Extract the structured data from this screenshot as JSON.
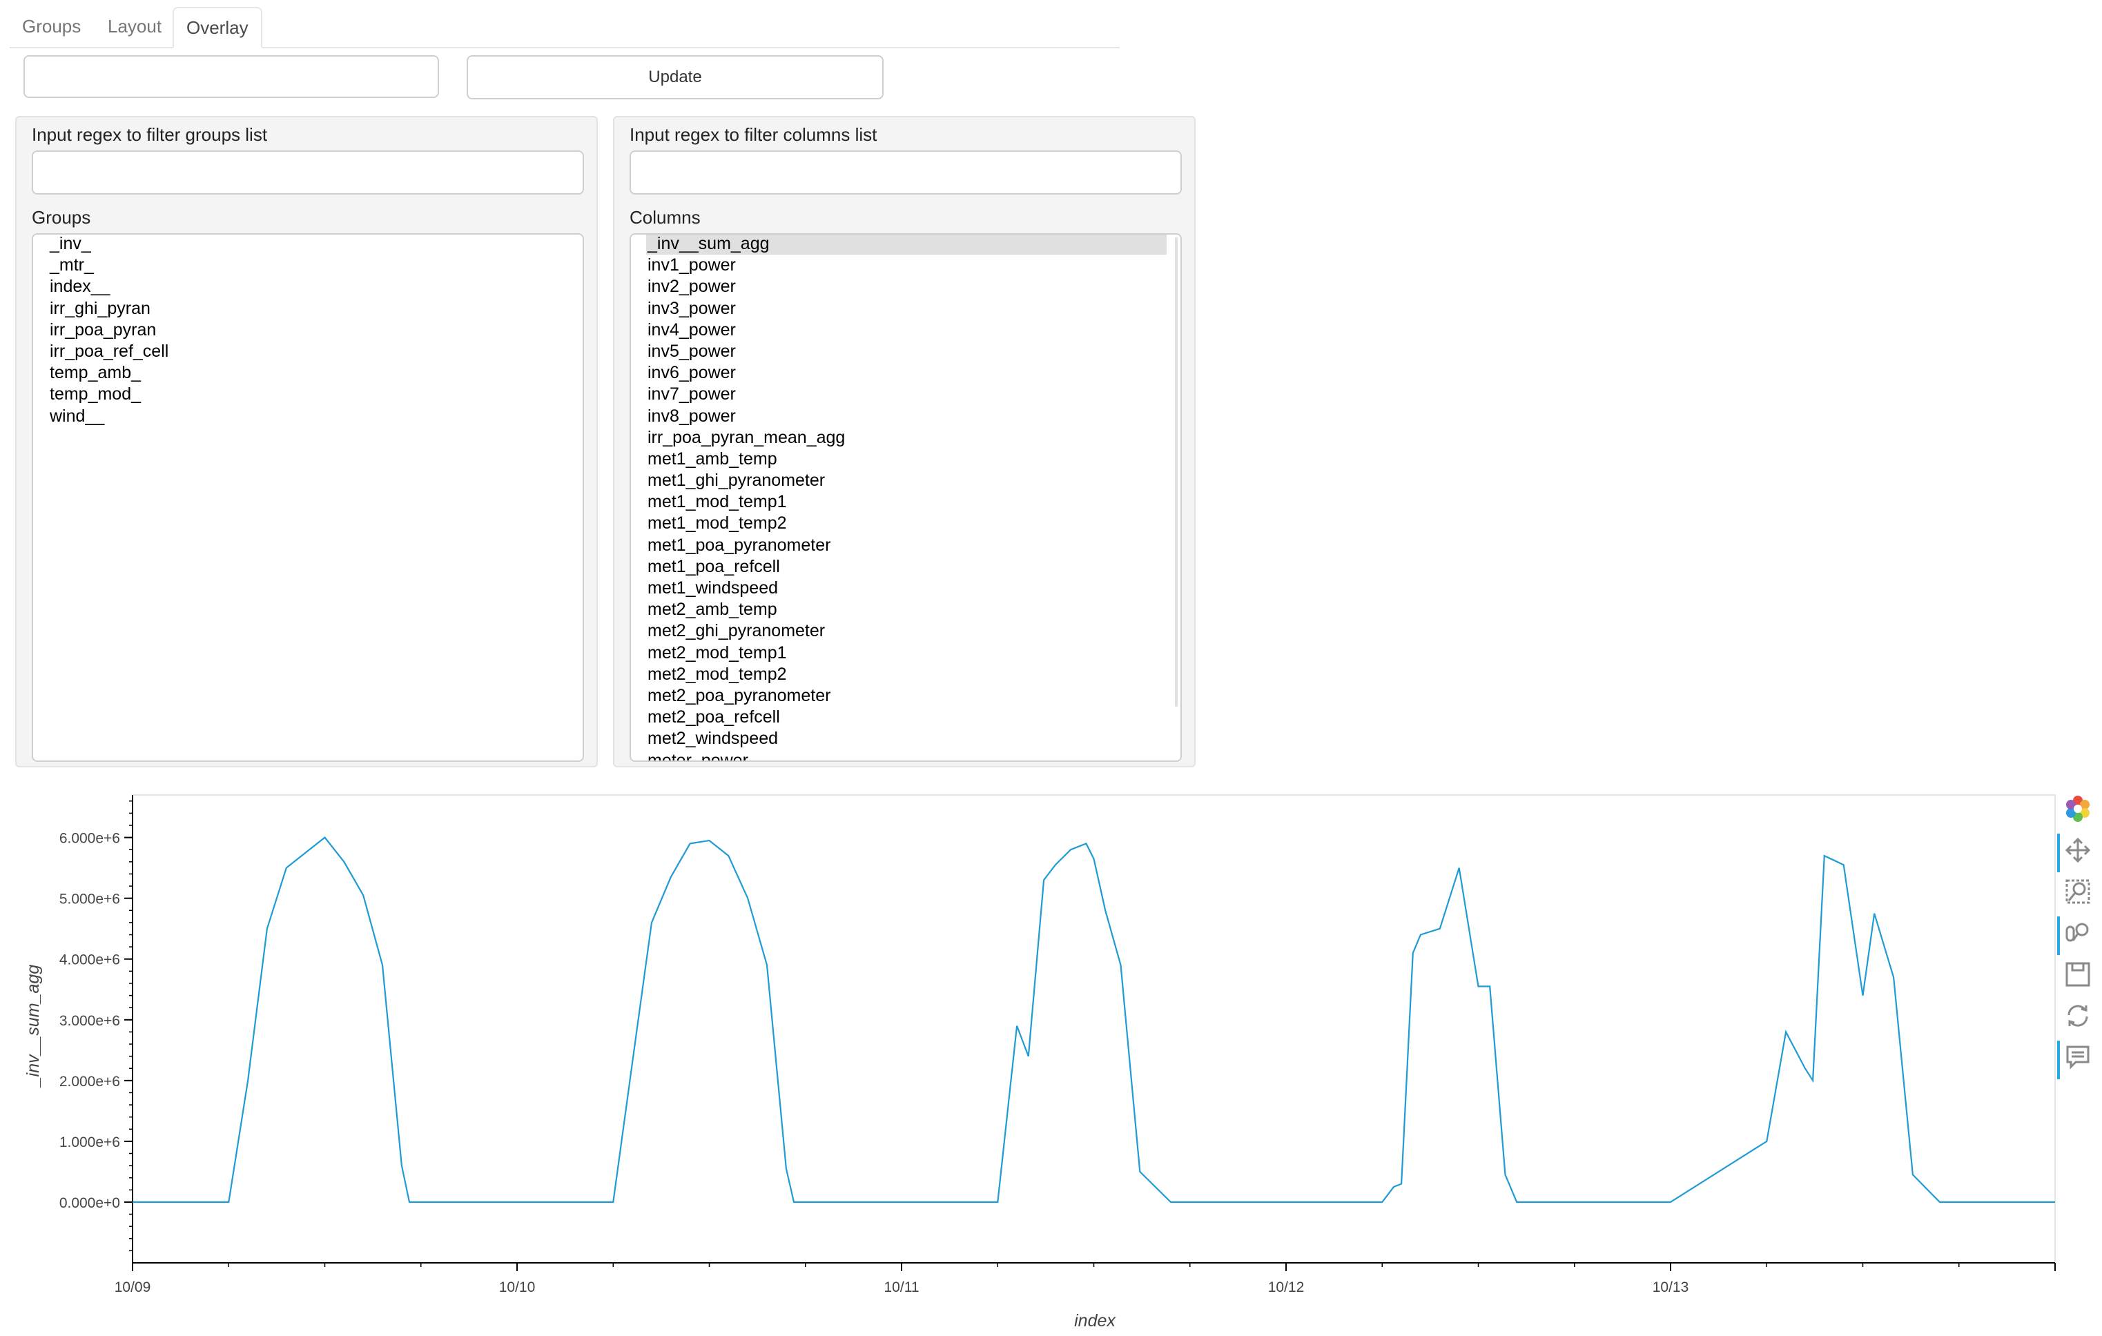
{
  "tabs": [
    {
      "label": "Groups"
    },
    {
      "label": "Layout"
    },
    {
      "label": "Overlay",
      "active": true
    }
  ],
  "controls": {
    "top_input_value": "",
    "update_label": "Update"
  },
  "groups_panel": {
    "filter_label": "Input regex to filter groups list",
    "filter_value": "",
    "list_label": "Groups",
    "items": [
      "_inv_",
      "_mtr_",
      "index__",
      "irr_ghi_pyran",
      "irr_poa_pyran",
      "irr_poa_ref_cell",
      "temp_amb_",
      "temp_mod_",
      "wind__"
    ]
  },
  "columns_panel": {
    "filter_label": "Input regex to filter columns list",
    "filter_value": "",
    "list_label": "Columns",
    "selected": "_inv__sum_agg",
    "items": [
      "_inv__sum_agg",
      "inv1_power",
      "inv2_power",
      "inv3_power",
      "inv4_power",
      "inv5_power",
      "inv6_power",
      "inv7_power",
      "inv8_power",
      "irr_poa_pyran_mean_agg",
      "met1_amb_temp",
      "met1_ghi_pyranometer",
      "met1_mod_temp1",
      "met1_mod_temp2",
      "met1_poa_pyranometer",
      "met1_poa_refcell",
      "met1_windspeed",
      "met2_amb_temp",
      "met2_ghi_pyranometer",
      "met2_mod_temp1",
      "met2_mod_temp2",
      "met2_poa_pyranometer",
      "met2_poa_refcell",
      "met2_windspeed",
      "meter_power"
    ]
  },
  "toolbar": {
    "icons": [
      "bokeh-logo-icon",
      "pan-icon",
      "box-zoom-icon",
      "wheel-zoom-icon",
      "save-icon",
      "reset-icon",
      "hover-icon"
    ]
  },
  "chart_data": {
    "type": "line",
    "xlabel": "index",
    "ylabel": "_inv__sum_agg",
    "line_color": "#1f9bd6",
    "x_ticks": [
      "10/09",
      "10/10",
      "10/11",
      "10/12",
      "10/13"
    ],
    "xlim_days": [
      0,
      5.0
    ],
    "y_ticks": [
      "0.000e+0",
      "1.000e+6",
      "2.000e+6",
      "3.000e+6",
      "4.000e+6",
      "5.000e+6",
      "6.000e+6"
    ],
    "ylim": [
      -1000000,
      6700000
    ],
    "grid": false,
    "series": [
      {
        "x": [
          0,
          0.25,
          0.3,
          0.35,
          0.4,
          0.45,
          0.5,
          0.55,
          0.6,
          0.65,
          0.7,
          0.72,
          0.75,
          1.0,
          1.25,
          1.3,
          1.35,
          1.4,
          1.45,
          1.5,
          1.55,
          1.6,
          1.65,
          1.7,
          1.72,
          1.75,
          2.0,
          2.25,
          2.3,
          2.33,
          2.37,
          2.4,
          2.44,
          2.48,
          2.5,
          2.53,
          2.57,
          2.62,
          2.7,
          2.75,
          3.0,
          3.25,
          3.28,
          3.3,
          3.33,
          3.35,
          3.4,
          3.45,
          3.5,
          3.53,
          3.57,
          3.6,
          3.7,
          3.75,
          4.0,
          4.25,
          4.3,
          4.35,
          4.37,
          4.4,
          4.45,
          4.5,
          4.53,
          4.58,
          4.63,
          4.7,
          4.75,
          5.0
        ],
        "y": [
          0,
          0,
          2000000,
          4500000,
          5500000,
          5750000,
          6000000,
          5600000,
          5050000,
          3900000,
          600000,
          0,
          0,
          0,
          0,
          2300000,
          4600000,
          5350000,
          5900000,
          5950000,
          5700000,
          5000000,
          3900000,
          550000,
          0,
          0,
          0,
          0,
          2900000,
          2400000,
          5300000,
          5550000,
          5800000,
          5900000,
          5650000,
          4800000,
          3900000,
          500000,
          0,
          0,
          0,
          0,
          250000,
          300000,
          4100000,
          4400000,
          4500000,
          5500000,
          3550000,
          3550000,
          450000,
          0,
          0,
          0,
          0,
          1000000,
          2800000,
          2200000,
          2000000,
          5700000,
          5550000,
          3400000,
          4750000,
          3700000,
          450000,
          0,
          0,
          0
        ]
      }
    ]
  }
}
